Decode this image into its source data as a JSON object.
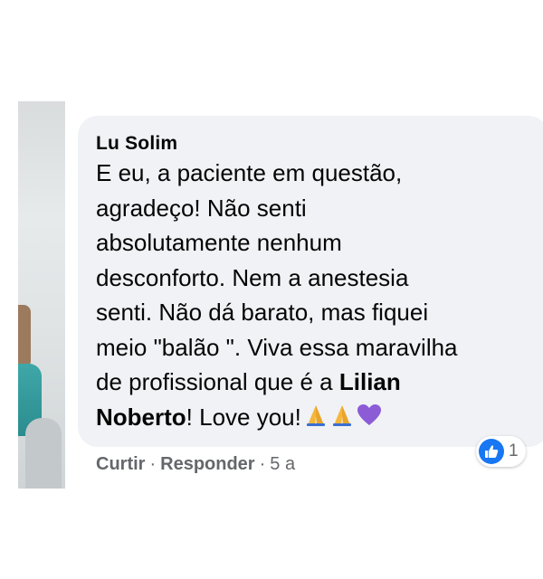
{
  "comment": {
    "author": "Lu Solim",
    "lines": [
      "E eu, a paciente em questão,",
      "agradeço! Não senti",
      "absolutamente nenhum",
      "desconforto. Nem a anestesia",
      "senti. Não dá barato, mas fiquei",
      "meio \"balão \". Viva essa maravilha",
      "de profissional que é a "
    ],
    "mention_part1": "Lilian",
    "mention_part2": "Noberto",
    "ending": "! Love you!",
    "emojis": [
      "folded-hands-icon",
      "folded-hands-icon",
      "purple-heart-icon"
    ]
  },
  "reaction": {
    "icon": "like-icon",
    "count": "1"
  },
  "actions": {
    "like_label": "Curtir",
    "separator": "·",
    "reply_label": "Responder",
    "time": "5 a"
  },
  "colors": {
    "bubble": "#f0f2f5",
    "text": "#050505",
    "muted": "#65676b",
    "like_blue": "#1877f2",
    "heart": "#8c5bd6",
    "hands": "#f5b73b"
  }
}
